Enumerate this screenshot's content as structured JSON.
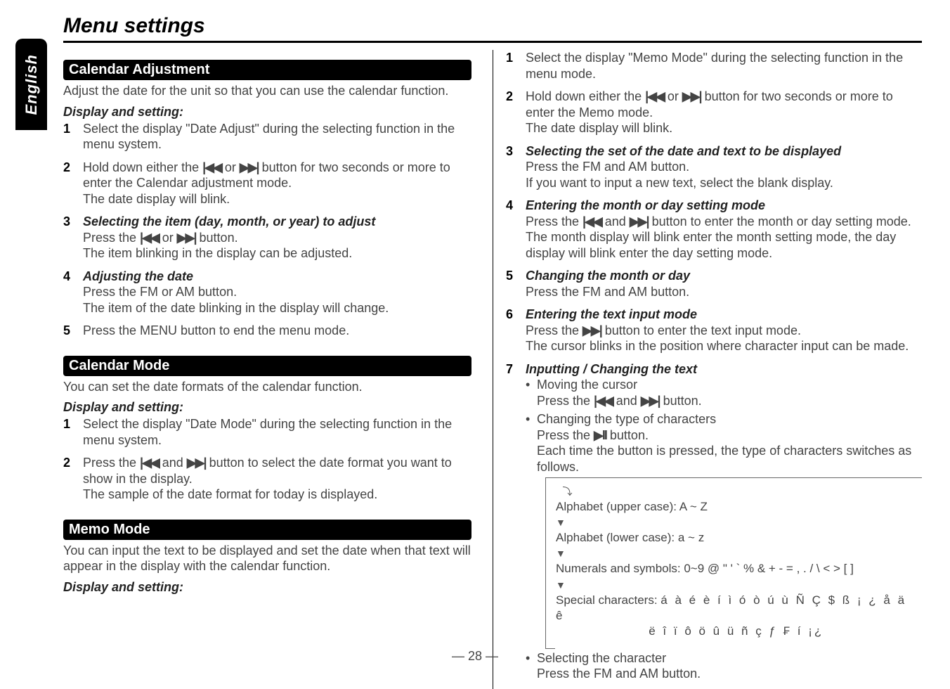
{
  "sideTab": "English",
  "title": "Menu settings",
  "left": {
    "calAdj": {
      "head": "Calendar Adjustment",
      "lead": "Adjust the date for the unit so that you can use the calendar function.",
      "dispSetting": "Display and setting:",
      "steps": {
        "s1": "Select the display \"Date Adjust\" during the selecting function in the menu system.",
        "s2a": "Hold down either the ",
        "s2b": " or ",
        "s2c": " button for two seconds or more to enter the Calendar adjustment mode.",
        "s2d": "The date display will blink.",
        "s3title": "Selecting the item (day, month, or year) to adjust",
        "s3a": "Press the ",
        "s3b": " or ",
        "s3c": " button.",
        "s3d": "The item blinking in the display can be adjusted.",
        "s4title": "Adjusting the date",
        "s4a": "Press the FM or AM button.",
        "s4b": "The item of the date blinking in the display will change.",
        "s5": "Press the MENU button to end the menu mode."
      }
    },
    "calMode": {
      "head": "Calendar Mode",
      "lead": "You can set the date formats of the calendar function.",
      "dispSetting": "Display and setting:",
      "steps": {
        "s1": "Select the display \"Date Mode\" during the selecting function in the menu system.",
        "s2a": "Press the ",
        "s2b": " and ",
        "s2c": " button to select the date format you want to show in the display.",
        "s2d": "The sample of the date format for today is displayed."
      }
    },
    "memo": {
      "head": "Memo Mode",
      "lead": "You can input the text to be displayed and set the date when that text will appear in the display with the calendar function.",
      "dispSetting": "Display and setting:"
    }
  },
  "right": {
    "steps": {
      "s1": "Select the display \"Memo Mode\" during the selecting function in the menu mode.",
      "s2a": "Hold down either the ",
      "s2b": " or ",
      "s2c": " button for two seconds or more to enter the Memo mode.",
      "s2d": "The date display will blink.",
      "s3title": "Selecting the set of the date and text to be displayed",
      "s3a": "Press the FM and AM button.",
      "s3b": "If you want to input a new text, select the blank display.",
      "s4title": "Entering the month or day setting mode",
      "s4a": "Press the ",
      "s4b": " and ",
      "s4c": " button to enter the month or day setting mode.",
      "s4d": "The month display will blink enter the month setting mode, the day display will blink enter the day setting mode.",
      "s5title": "Changing the month or day",
      "s5a": "Press the FM and AM button.",
      "s6title": "Entering the text input mode",
      "s6a": "Press the ",
      "s6b": " button to enter the text input mode.",
      "s6c": "The cursor blinks in the position where character input can be made.",
      "s7title": "Inputting / Changing the text",
      "s7bul1": "Moving the cursor",
      "s7bul1a": "Press the ",
      "s7bul1b": " and ",
      "s7bul1c": " button.",
      "s7bul2": "Changing the type of characters",
      "s7bul2a": "Press the ",
      "s7bul2b": " button.",
      "s7bul2c": "Each time the button is pressed, the type of characters switches as follows.",
      "flow": {
        "l1": "Alphabet (upper case): A ~ Z",
        "l2": "Alphabet (lower case): a ~ z",
        "l3": "Numerals and symbols: 0~9 @ \" ' ` % &      + - = , . / \\ < > [ ]",
        "l4a": "Special characters: ",
        "l4b": "á à é è í ì ó ò ú ù Ñ Ç $ ß ¡ ¿ å ä ê",
        "l4c": "ë î ï ô ö û ü ñ ç ƒ ₣ í ¡¿"
      },
      "s7bul3": "Selecting the character",
      "s7bul3a": "Press the FM and AM button."
    }
  },
  "icons": {
    "prev": "|◀◀",
    "next": "▶▶|",
    "playpause": "▶II"
  },
  "pageNum": "— 28 —"
}
